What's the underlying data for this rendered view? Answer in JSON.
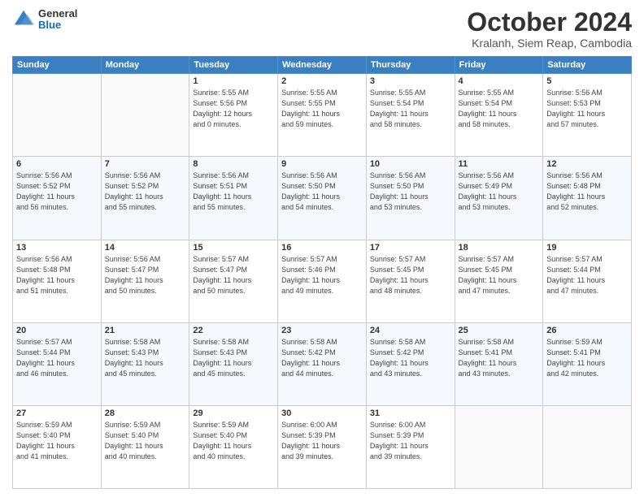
{
  "logo": {
    "general": "General",
    "blue": "Blue"
  },
  "header": {
    "month": "October 2024",
    "location": "Kralanh, Siem Reap, Cambodia"
  },
  "weekdays": [
    "Sunday",
    "Monday",
    "Tuesday",
    "Wednesday",
    "Thursday",
    "Friday",
    "Saturday"
  ],
  "weeks": [
    [
      {
        "day": "",
        "info": ""
      },
      {
        "day": "",
        "info": ""
      },
      {
        "day": "1",
        "info": "Sunrise: 5:55 AM\nSunset: 5:56 PM\nDaylight: 12 hours\nand 0 minutes."
      },
      {
        "day": "2",
        "info": "Sunrise: 5:55 AM\nSunset: 5:55 PM\nDaylight: 11 hours\nand 59 minutes."
      },
      {
        "day": "3",
        "info": "Sunrise: 5:55 AM\nSunset: 5:54 PM\nDaylight: 11 hours\nand 58 minutes."
      },
      {
        "day": "4",
        "info": "Sunrise: 5:55 AM\nSunset: 5:54 PM\nDaylight: 11 hours\nand 58 minutes."
      },
      {
        "day": "5",
        "info": "Sunrise: 5:56 AM\nSunset: 5:53 PM\nDaylight: 11 hours\nand 57 minutes."
      }
    ],
    [
      {
        "day": "6",
        "info": "Sunrise: 5:56 AM\nSunset: 5:52 PM\nDaylight: 11 hours\nand 56 minutes."
      },
      {
        "day": "7",
        "info": "Sunrise: 5:56 AM\nSunset: 5:52 PM\nDaylight: 11 hours\nand 55 minutes."
      },
      {
        "day": "8",
        "info": "Sunrise: 5:56 AM\nSunset: 5:51 PM\nDaylight: 11 hours\nand 55 minutes."
      },
      {
        "day": "9",
        "info": "Sunrise: 5:56 AM\nSunset: 5:50 PM\nDaylight: 11 hours\nand 54 minutes."
      },
      {
        "day": "10",
        "info": "Sunrise: 5:56 AM\nSunset: 5:50 PM\nDaylight: 11 hours\nand 53 minutes."
      },
      {
        "day": "11",
        "info": "Sunrise: 5:56 AM\nSunset: 5:49 PM\nDaylight: 11 hours\nand 53 minutes."
      },
      {
        "day": "12",
        "info": "Sunrise: 5:56 AM\nSunset: 5:48 PM\nDaylight: 11 hours\nand 52 minutes."
      }
    ],
    [
      {
        "day": "13",
        "info": "Sunrise: 5:56 AM\nSunset: 5:48 PM\nDaylight: 11 hours\nand 51 minutes."
      },
      {
        "day": "14",
        "info": "Sunrise: 5:56 AM\nSunset: 5:47 PM\nDaylight: 11 hours\nand 50 minutes."
      },
      {
        "day": "15",
        "info": "Sunrise: 5:57 AM\nSunset: 5:47 PM\nDaylight: 11 hours\nand 50 minutes."
      },
      {
        "day": "16",
        "info": "Sunrise: 5:57 AM\nSunset: 5:46 PM\nDaylight: 11 hours\nand 49 minutes."
      },
      {
        "day": "17",
        "info": "Sunrise: 5:57 AM\nSunset: 5:45 PM\nDaylight: 11 hours\nand 48 minutes."
      },
      {
        "day": "18",
        "info": "Sunrise: 5:57 AM\nSunset: 5:45 PM\nDaylight: 11 hours\nand 47 minutes."
      },
      {
        "day": "19",
        "info": "Sunrise: 5:57 AM\nSunset: 5:44 PM\nDaylight: 11 hours\nand 47 minutes."
      }
    ],
    [
      {
        "day": "20",
        "info": "Sunrise: 5:57 AM\nSunset: 5:44 PM\nDaylight: 11 hours\nand 46 minutes."
      },
      {
        "day": "21",
        "info": "Sunrise: 5:58 AM\nSunset: 5:43 PM\nDaylight: 11 hours\nand 45 minutes."
      },
      {
        "day": "22",
        "info": "Sunrise: 5:58 AM\nSunset: 5:43 PM\nDaylight: 11 hours\nand 45 minutes."
      },
      {
        "day": "23",
        "info": "Sunrise: 5:58 AM\nSunset: 5:42 PM\nDaylight: 11 hours\nand 44 minutes."
      },
      {
        "day": "24",
        "info": "Sunrise: 5:58 AM\nSunset: 5:42 PM\nDaylight: 11 hours\nand 43 minutes."
      },
      {
        "day": "25",
        "info": "Sunrise: 5:58 AM\nSunset: 5:41 PM\nDaylight: 11 hours\nand 43 minutes."
      },
      {
        "day": "26",
        "info": "Sunrise: 5:59 AM\nSunset: 5:41 PM\nDaylight: 11 hours\nand 42 minutes."
      }
    ],
    [
      {
        "day": "27",
        "info": "Sunrise: 5:59 AM\nSunset: 5:40 PM\nDaylight: 11 hours\nand 41 minutes."
      },
      {
        "day": "28",
        "info": "Sunrise: 5:59 AM\nSunset: 5:40 PM\nDaylight: 11 hours\nand 40 minutes."
      },
      {
        "day": "29",
        "info": "Sunrise: 5:59 AM\nSunset: 5:40 PM\nDaylight: 11 hours\nand 40 minutes."
      },
      {
        "day": "30",
        "info": "Sunrise: 6:00 AM\nSunset: 5:39 PM\nDaylight: 11 hours\nand 39 minutes."
      },
      {
        "day": "31",
        "info": "Sunrise: 6:00 AM\nSunset: 5:39 PM\nDaylight: 11 hours\nand 39 minutes."
      },
      {
        "day": "",
        "info": ""
      },
      {
        "day": "",
        "info": ""
      }
    ]
  ]
}
